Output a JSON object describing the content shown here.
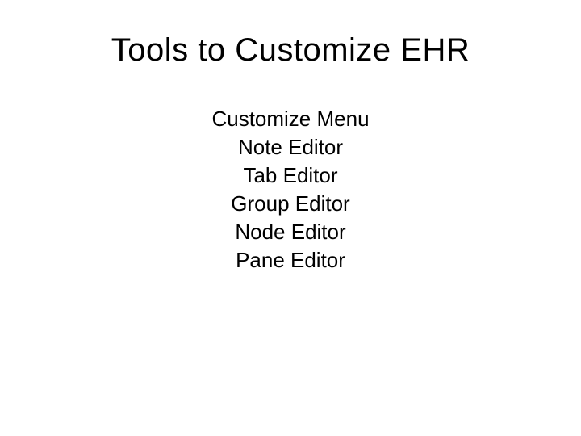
{
  "title": "Tools to Customize EHR",
  "items": [
    "Customize Menu",
    "Note Editor",
    "Tab Editor",
    "Group Editor",
    "Node Editor",
    "Pane Editor"
  ]
}
